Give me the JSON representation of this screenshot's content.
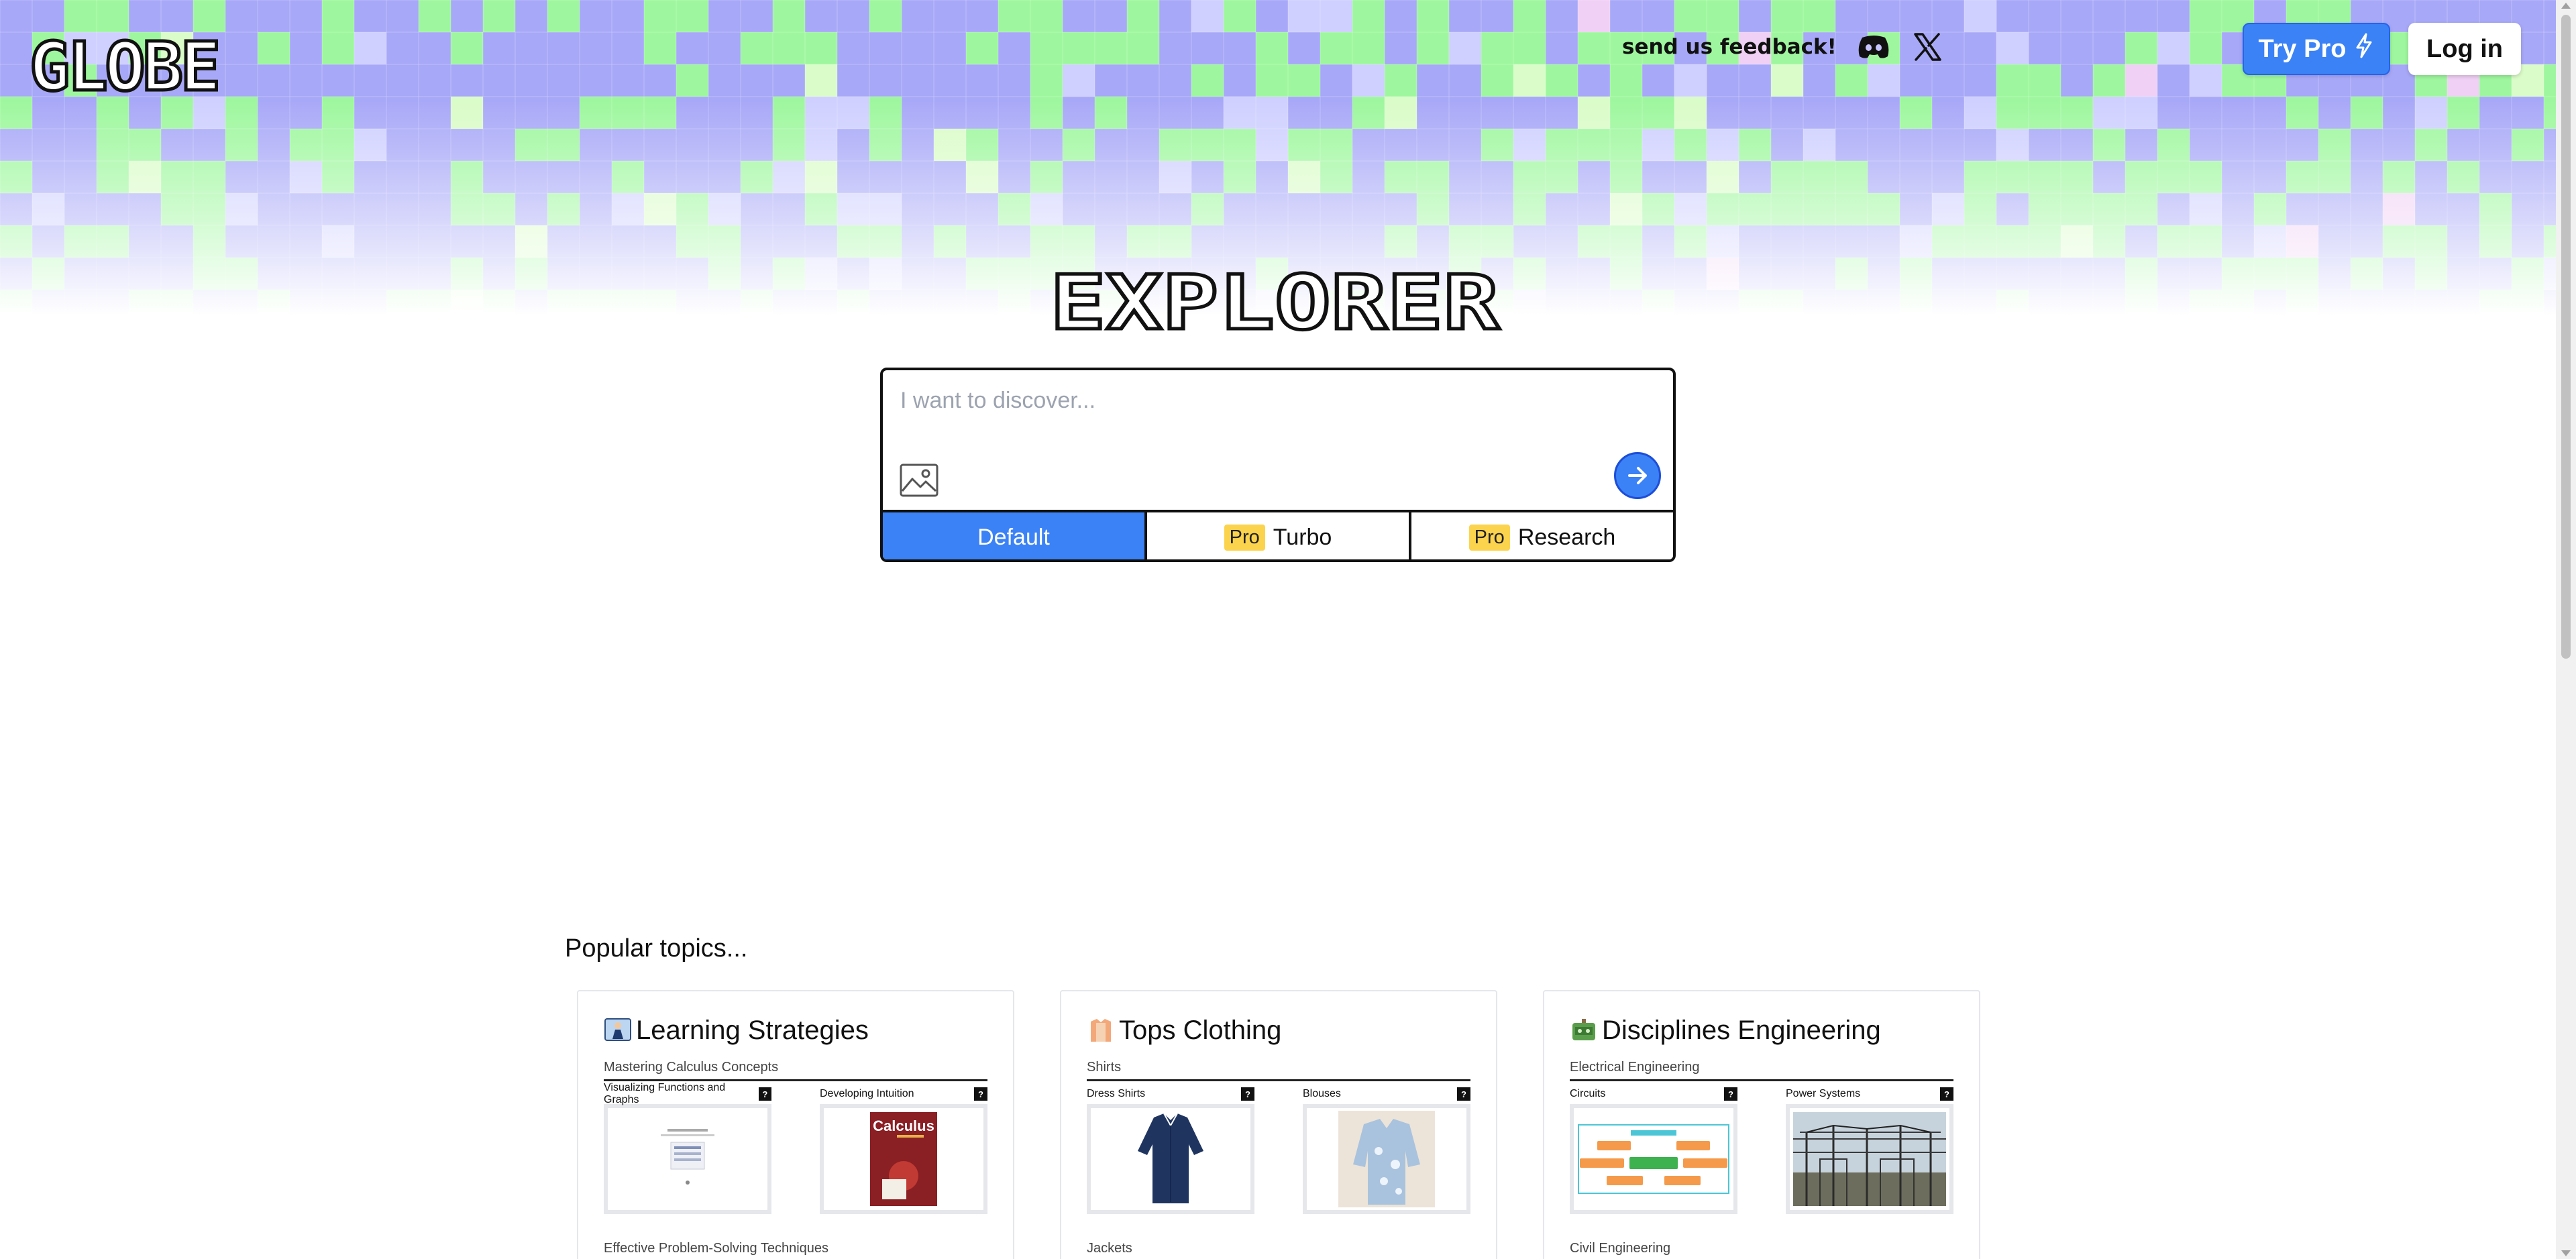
{
  "header": {
    "logo_text": "GLOBE",
    "feedback_text": "send us feedback!",
    "discord_icon": "discord-icon",
    "x_icon": "x-twitter-icon",
    "try_pro_label": "Try Pro",
    "try_pro_icon": "lightning-bolt-icon",
    "login_label": "Log in"
  },
  "colors": {
    "accent_blue": "#3b82f6",
    "pro_badge": "#fcd34d",
    "mosaic_purple": "#a8a8f8",
    "mosaic_green": "#9ef79e"
  },
  "title": "EXPLORER",
  "search": {
    "placeholder": "I want to discover...",
    "value": "",
    "image_icon": "image-upload-icon",
    "submit_icon": "arrow-right-icon"
  },
  "modes": [
    {
      "label": "Default",
      "pro": "",
      "active": true
    },
    {
      "label": "Turbo",
      "pro": "Pro",
      "active": false
    },
    {
      "label": "Research",
      "pro": "Pro",
      "active": false
    }
  ],
  "popular": {
    "label": "Popular topics...",
    "cards": [
      {
        "title": "Learning Strategies",
        "emoji_icon": "teacher-icon",
        "section": "Mastering Calculus Concepts",
        "items": [
          {
            "label": "Visualizing Functions and Graphs",
            "q": "?"
          },
          {
            "label": "Developing Intuition",
            "q": "?"
          }
        ],
        "book_title": "Calculus",
        "next_section": "Effective Problem-Solving Techniques"
      },
      {
        "title": "Tops Clothing",
        "emoji_icon": "shirt-icon",
        "section": "Shirts",
        "items": [
          {
            "label": "Dress Shirts",
            "q": "?"
          },
          {
            "label": "Blouses",
            "q": "?"
          }
        ],
        "next_section": "Jackets"
      },
      {
        "title": "Disciplines Engineering",
        "emoji_icon": "robot-icon",
        "section": "Electrical Engineering",
        "items": [
          {
            "label": "Circuits",
            "q": "?"
          },
          {
            "label": "Power Systems",
            "q": "?"
          }
        ],
        "next_section": "Civil Engineering"
      }
    ]
  }
}
